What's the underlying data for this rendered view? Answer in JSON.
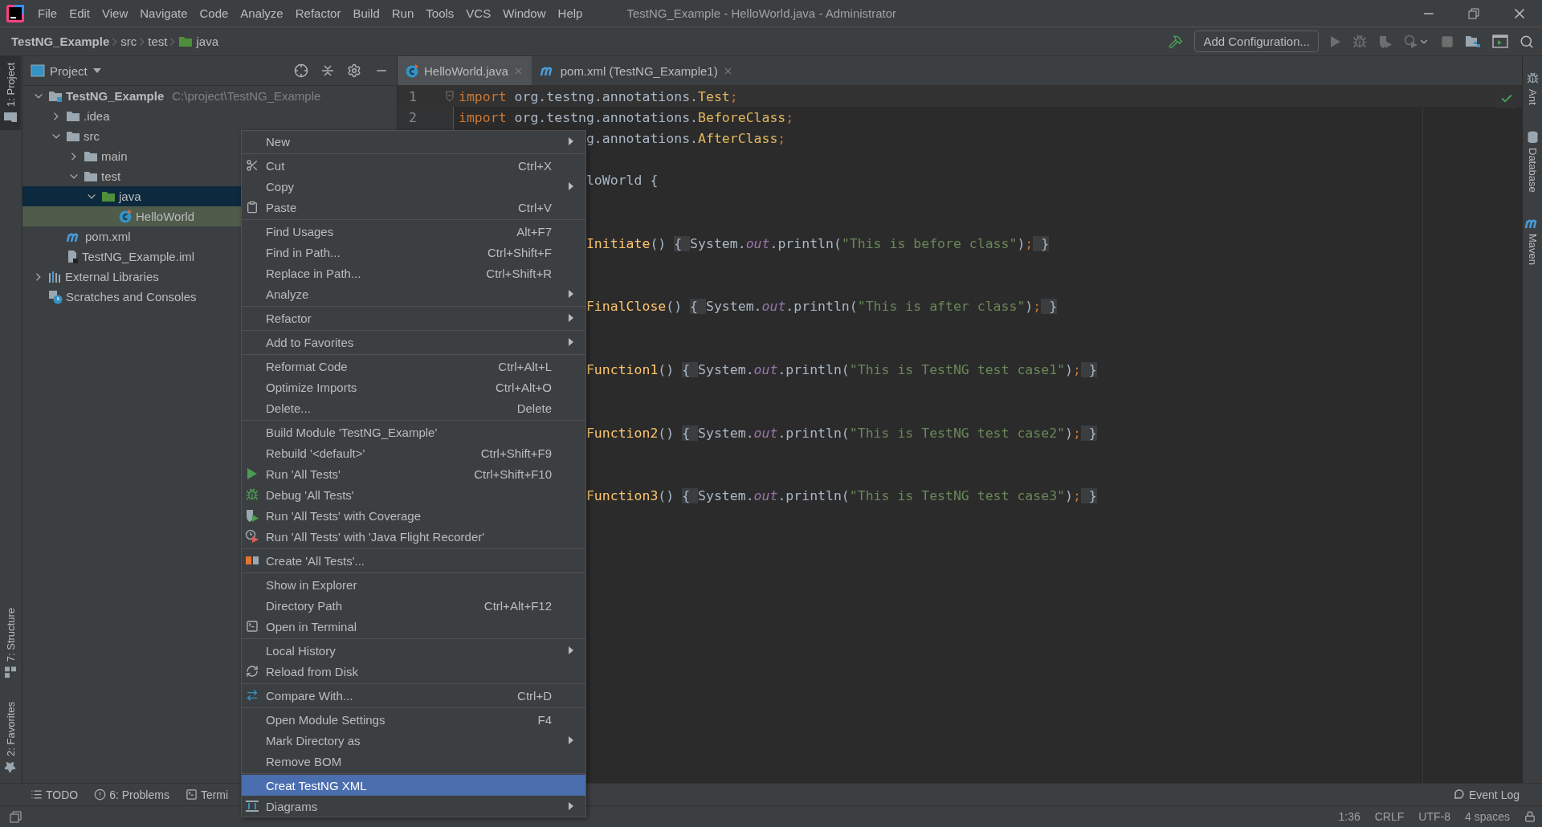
{
  "window": {
    "title": "TestNG_Example - HelloWorld.java - Administrator"
  },
  "menu_bar": [
    "File",
    "Edit",
    "View",
    "Navigate",
    "Code",
    "Analyze",
    "Refactor",
    "Build",
    "Run",
    "Tools",
    "VCS",
    "Window",
    "Help"
  ],
  "breadcrumbs": [
    {
      "label": "TestNG_Example",
      "kind": "project"
    },
    {
      "label": "src",
      "kind": "plain"
    },
    {
      "label": "test",
      "kind": "plain"
    },
    {
      "label": "java",
      "kind": "source"
    }
  ],
  "toolbar": {
    "configuration": "Add Configuration...",
    "run_disabled": true
  },
  "left_stripe": {
    "top": [
      {
        "label": "1: Project",
        "kind": "project",
        "selected": true
      }
    ],
    "bottom": [
      {
        "label": "7: Structure",
        "kind": "structure",
        "selected": false
      },
      {
        "label": "2: Favorites",
        "kind": "favorites",
        "selected": false
      }
    ]
  },
  "right_stripe": [
    {
      "label": "Ant",
      "kind": "ant"
    },
    {
      "label": "Database",
      "kind": "database"
    },
    {
      "label": "Maven",
      "kind": "maven"
    }
  ],
  "project_panel": {
    "title": "Project",
    "tree": [
      {
        "label": "TestNG_Example",
        "path": "C:\\project\\TestNG_Example",
        "kind": "module",
        "expanded": true,
        "selected": false,
        "highlighted": false,
        "children": [
          {
            "label": ".idea",
            "kind": "folder",
            "expanded": false,
            "selected": false,
            "highlighted": false
          },
          {
            "label": "src",
            "kind": "folder",
            "expanded": true,
            "selected": false,
            "highlighted": false,
            "children": [
              {
                "label": "main",
                "kind": "folder",
                "expanded": false,
                "selected": false,
                "highlighted": false
              },
              {
                "label": "test",
                "kind": "folder",
                "expanded": true,
                "selected": false,
                "highlighted": false,
                "children": [
                  {
                    "label": "java",
                    "kind": "source",
                    "expanded": true,
                    "selected": true,
                    "highlighted": false,
                    "children": [
                      {
                        "label": "HelloWorld",
                        "kind": "class",
                        "selected": false,
                        "highlighted": true
                      }
                    ]
                  }
                ]
              }
            ]
          },
          {
            "label": "pom.xml",
            "kind": "maven",
            "selected": false,
            "highlighted": false
          },
          {
            "label": "TestNG_Example.iml",
            "kind": "module-file",
            "selected": false,
            "highlighted": false
          }
        ]
      },
      {
        "label": "External Libraries",
        "kind": "libraries",
        "expanded": false,
        "selected": false,
        "highlighted": false
      },
      {
        "label": "Scratches and Consoles",
        "kind": "scratches",
        "selected": false,
        "highlighted": false
      }
    ]
  },
  "editor": {
    "tabs": [
      {
        "label": "HelloWorld.java",
        "kind": "class",
        "selected": true
      },
      {
        "label": "pom.xml (TestNG_Example1)",
        "kind": "maven",
        "selected": false
      }
    ],
    "inspection_ok": true,
    "lines": [
      {
        "kind": "full",
        "number": "1",
        "caret": true,
        "fold": true,
        "tokens": [
          {
            "kind": "keyword",
            "text": "import"
          },
          {
            "kind": "plain",
            "text": " org.testng.annotations."
          },
          {
            "kind": "type",
            "text": "Test"
          },
          {
            "kind": "keyword",
            "text": ";"
          }
        ]
      },
      {
        "kind": "full",
        "number": "2",
        "caret": false,
        "fold": false,
        "tokens": [
          {
            "kind": "keyword",
            "text": "import"
          },
          {
            "kind": "plain",
            "text": " org.testng.annotations."
          },
          {
            "kind": "type",
            "text": "BeforeClass"
          },
          {
            "kind": "keyword",
            "text": ";"
          }
        ]
      },
      {
        "kind": "clipped",
        "tokens": [
          {
            "kind": "plain",
            "text": "g.annotations."
          },
          {
            "kind": "type",
            "text": "AfterClass"
          },
          {
            "kind": "keyword",
            "text": ";"
          }
        ]
      },
      {
        "kind": "blank"
      },
      {
        "kind": "clipped",
        "tokens": [
          {
            "kind": "plain",
            "text": "loWorld {"
          }
        ]
      },
      {
        "kind": "blank"
      },
      {
        "kind": "blank"
      },
      {
        "kind": "clipped",
        "tokens": [
          {
            "kind": "method",
            "text": "Initiate"
          },
          {
            "kind": "plain",
            "text": "() "
          },
          {
            "kind": "fold",
            "text": "{ "
          },
          {
            "kind": "plain",
            "text": "System."
          },
          {
            "kind": "field",
            "text": "out"
          },
          {
            "kind": "plain",
            "text": ".println("
          },
          {
            "kind": "string",
            "text": "\"This is before class\""
          },
          {
            "kind": "plain",
            "text": ")"
          },
          {
            "kind": "keyword",
            "text": ";"
          },
          {
            "kind": "fold",
            "text": " }"
          }
        ]
      },
      {
        "kind": "blank"
      },
      {
        "kind": "blank"
      },
      {
        "kind": "clipped",
        "tokens": [
          {
            "kind": "method",
            "text": "FinalClose"
          },
          {
            "kind": "plain",
            "text": "() "
          },
          {
            "kind": "fold",
            "text": "{ "
          },
          {
            "kind": "plain",
            "text": "System."
          },
          {
            "kind": "field",
            "text": "out"
          },
          {
            "kind": "plain",
            "text": ".println("
          },
          {
            "kind": "string",
            "text": "\"This is after class\""
          },
          {
            "kind": "plain",
            "text": ")"
          },
          {
            "kind": "keyword",
            "text": ";"
          },
          {
            "kind": "fold",
            "text": " }"
          }
        ]
      },
      {
        "kind": "blank"
      },
      {
        "kind": "blank"
      },
      {
        "kind": "clipped",
        "tokens": [
          {
            "kind": "method",
            "text": "Function1"
          },
          {
            "kind": "plain",
            "text": "() "
          },
          {
            "kind": "fold",
            "text": "{ "
          },
          {
            "kind": "plain",
            "text": "System."
          },
          {
            "kind": "field",
            "text": "out"
          },
          {
            "kind": "plain",
            "text": ".println("
          },
          {
            "kind": "string",
            "text": "\"This is TestNG test case1\""
          },
          {
            "kind": "plain",
            "text": ")"
          },
          {
            "kind": "keyword",
            "text": ";"
          },
          {
            "kind": "fold",
            "text": " }"
          }
        ]
      },
      {
        "kind": "blank"
      },
      {
        "kind": "blank"
      },
      {
        "kind": "clipped",
        "tokens": [
          {
            "kind": "method",
            "text": "Function2"
          },
          {
            "kind": "plain",
            "text": "() "
          },
          {
            "kind": "fold",
            "text": "{ "
          },
          {
            "kind": "plain",
            "text": "System."
          },
          {
            "kind": "field",
            "text": "out"
          },
          {
            "kind": "plain",
            "text": ".println("
          },
          {
            "kind": "string",
            "text": "\"This is TestNG test case2\""
          },
          {
            "kind": "plain",
            "text": ")"
          },
          {
            "kind": "keyword",
            "text": ";"
          },
          {
            "kind": "fold",
            "text": " }"
          }
        ]
      },
      {
        "kind": "blank"
      },
      {
        "kind": "blank"
      },
      {
        "kind": "clipped",
        "tokens": [
          {
            "kind": "method",
            "text": "Function3"
          },
          {
            "kind": "plain",
            "text": "() "
          },
          {
            "kind": "fold",
            "text": "{ "
          },
          {
            "kind": "plain",
            "text": "System."
          },
          {
            "kind": "field",
            "text": "out"
          },
          {
            "kind": "plain",
            "text": ".println("
          },
          {
            "kind": "string",
            "text": "\"This is TestNG test case3\""
          },
          {
            "kind": "plain",
            "text": ")"
          },
          {
            "kind": "keyword",
            "text": ";"
          },
          {
            "kind": "fold",
            "text": " }"
          }
        ]
      }
    ]
  },
  "context_menu": {
    "groups": [
      [
        {
          "label": "New",
          "kind": "plain",
          "submenu": true,
          "selected": false
        }
      ],
      [
        {
          "label": "Cut",
          "shortcut": "Ctrl+X",
          "kind": "cut",
          "submenu": false,
          "selected": false
        },
        {
          "label": "Copy",
          "kind": "plain",
          "submenu": true,
          "selected": false
        },
        {
          "label": "Paste",
          "shortcut": "Ctrl+V",
          "kind": "paste",
          "submenu": false,
          "selected": false
        }
      ],
      [
        {
          "label": "Find Usages",
          "shortcut": "Alt+F7",
          "kind": "plain",
          "submenu": false,
          "selected": false
        },
        {
          "label": "Find in Path...",
          "shortcut": "Ctrl+Shift+F",
          "kind": "plain",
          "submenu": false,
          "selected": false
        },
        {
          "label": "Replace in Path...",
          "shortcut": "Ctrl+Shift+R",
          "kind": "plain",
          "submenu": false,
          "selected": false
        },
        {
          "label": "Analyze",
          "kind": "plain",
          "submenu": true,
          "selected": false
        }
      ],
      [
        {
          "label": "Refactor",
          "kind": "plain",
          "submenu": true,
          "selected": false
        }
      ],
      [
        {
          "label": "Add to Favorites",
          "kind": "plain",
          "submenu": true,
          "selected": false
        }
      ],
      [
        {
          "label": "Reformat Code",
          "shortcut": "Ctrl+Alt+L",
          "kind": "plain",
          "submenu": false,
          "selected": false
        },
        {
          "label": "Optimize Imports",
          "shortcut": "Ctrl+Alt+O",
          "kind": "plain",
          "submenu": false,
          "selected": false
        },
        {
          "label": "Delete...",
          "shortcut": "Delete",
          "kind": "plain",
          "submenu": false,
          "selected": false
        }
      ],
      [
        {
          "label": "Build Module 'TestNG_Example'",
          "kind": "plain",
          "submenu": false,
          "selected": false
        },
        {
          "label": "Rebuild '<default>'",
          "shortcut": "Ctrl+Shift+F9",
          "kind": "plain",
          "submenu": false,
          "selected": false
        },
        {
          "label": "Run 'All Tests'",
          "shortcut": "Ctrl+Shift+F10",
          "kind": "run",
          "submenu": false,
          "selected": false
        },
        {
          "label": "Debug 'All Tests'",
          "kind": "debug",
          "submenu": false,
          "selected": false
        },
        {
          "label": "Run 'All Tests' with Coverage",
          "kind": "coverage",
          "submenu": false,
          "selected": false
        },
        {
          "label": "Run 'All Tests' with 'Java Flight Recorder'",
          "kind": "profiler",
          "submenu": false,
          "selected": false
        }
      ],
      [
        {
          "label": "Create 'All Tests'...",
          "kind": "testng",
          "submenu": false,
          "selected": false
        }
      ],
      [
        {
          "label": "Show in Explorer",
          "kind": "plain",
          "submenu": false,
          "selected": false
        },
        {
          "label": "Directory Path",
          "shortcut": "Ctrl+Alt+F12",
          "kind": "plain",
          "submenu": false,
          "selected": false
        },
        {
          "label": "Open in Terminal",
          "kind": "terminal",
          "submenu": false,
          "selected": false
        }
      ],
      [
        {
          "label": "Local History",
          "kind": "plain",
          "submenu": true,
          "selected": false
        },
        {
          "label": "Reload from Disk",
          "kind": "reload",
          "submenu": false,
          "selected": false
        }
      ],
      [
        {
          "label": "Compare With...",
          "shortcut": "Ctrl+D",
          "kind": "compare",
          "submenu": false,
          "selected": false
        }
      ],
      [
        {
          "label": "Open Module Settings",
          "shortcut": "F4",
          "kind": "plain",
          "submenu": false,
          "selected": false
        },
        {
          "label": "Mark Directory as",
          "kind": "plain",
          "submenu": true,
          "selected": false
        },
        {
          "label": "Remove BOM",
          "kind": "plain",
          "submenu": false,
          "selected": false
        }
      ],
      [
        {
          "label": "Creat TestNG XML",
          "kind": "plain",
          "submenu": false,
          "selected": true
        },
        {
          "label": "Diagrams",
          "kind": "diagrams",
          "submenu": true,
          "selected": false
        }
      ]
    ]
  },
  "tool_window_bar": {
    "items": [
      {
        "label": "TODO",
        "kind": "todo"
      },
      {
        "label": "6: Problems",
        "kind": "problems"
      },
      {
        "label": "Termi",
        "kind": "terminal"
      }
    ],
    "event_log": "Event Log"
  },
  "status_bar": {
    "position": "1:36",
    "line_separator": "CRLF",
    "encoding": "UTF-8",
    "indent": "4 spaces"
  }
}
